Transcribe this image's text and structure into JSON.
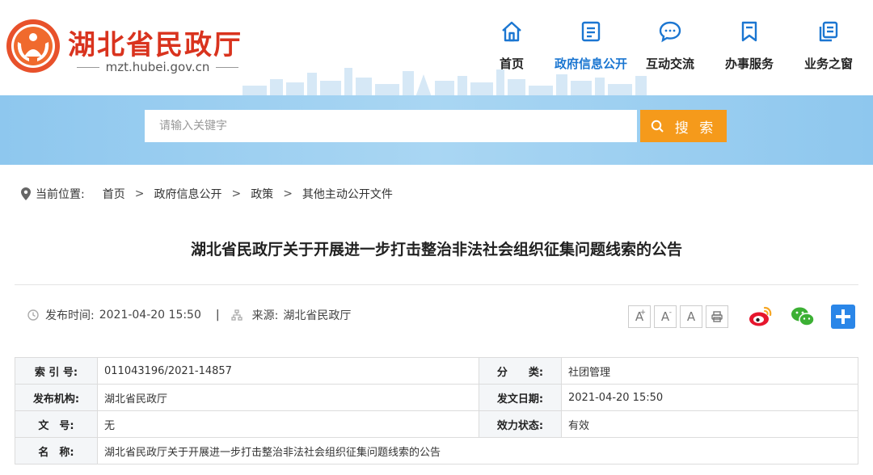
{
  "site": {
    "title": "湖北省民政厅",
    "url": "mzt.hubei.gov.cn"
  },
  "nav": {
    "items": [
      {
        "label": "首页",
        "icon": "home-icon",
        "active": false
      },
      {
        "label": "政府信息公开",
        "icon": "document-list-icon",
        "active": true
      },
      {
        "label": "互动交流",
        "icon": "chat-bubble-icon",
        "active": false
      },
      {
        "label": "办事服务",
        "icon": "bookmark-icon",
        "active": false
      },
      {
        "label": "业务之窗",
        "icon": "copy-icon",
        "active": false
      }
    ]
  },
  "search": {
    "placeholder": "请输入关键字",
    "button_label": "搜 索"
  },
  "breadcrumb": {
    "prefix": "当前位置:",
    "items": [
      "首页",
      "政府信息公开",
      "政策",
      "其他主动公开文件"
    ],
    "separator": ">"
  },
  "article": {
    "title": "湖北省民政厅关于开展进一步打击整治非法社会组织征集问题线索的公告",
    "publish_label": "发布时间:",
    "publish_time": "2021-04-20 15:50",
    "separator": "|",
    "source_label": "来源:",
    "source": "湖北省民政厅"
  },
  "tools": {
    "font_large": "A",
    "font_large_mark": "+",
    "font_small": "A",
    "font_small_mark": "-",
    "font_reset": "A"
  },
  "info": {
    "rows": [
      [
        {
          "k": "索 引 号:",
          "v": "011043196/2021-14857"
        },
        {
          "k": "分　　类:",
          "v": "社团管理"
        }
      ],
      [
        {
          "k": "发布机构:",
          "v": "湖北省民政厅"
        },
        {
          "k": "发文日期:",
          "v": "2021-04-20 15:50"
        }
      ],
      [
        {
          "k": "文　号:",
          "v": "无"
        },
        {
          "k": "效力状态:",
          "v": "有效"
        }
      ]
    ],
    "name_label": "名　称:",
    "name_value": "湖北省民政厅关于开展进一步打击整治非法社会组织征集问题线索的公告"
  },
  "colors": {
    "brand_red": "#d9331e",
    "nav_active": "#1b76d1",
    "search_button": "#f59a1b",
    "search_band": "#a9d6f3"
  }
}
